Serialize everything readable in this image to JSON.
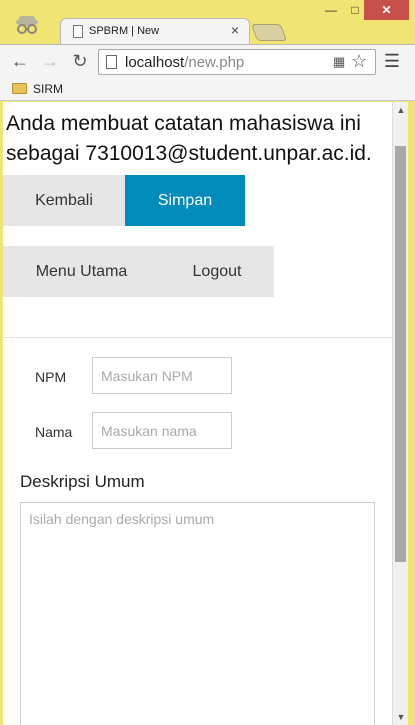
{
  "browser": {
    "tab_title": "SPBRM | New",
    "url_host": "localhost",
    "url_path": "/new.php",
    "bookmark": "SIRM",
    "close_glyph": "×"
  },
  "page": {
    "intro": "Anda membuat catatan mahasiswa ini sebagai 7310013@student.unpar.ac.id.",
    "buttons": {
      "back": "Kembali",
      "save": "Simpan",
      "main_menu": "Menu Utama",
      "logout": "Logout"
    },
    "form": {
      "npm_label": "NPM",
      "npm_placeholder": "Masukan NPM",
      "name_label": "Nama",
      "name_placeholder": "Masukan nama",
      "section_title": "Deskripsi Umum",
      "desc_placeholder": "Isilah dengan deskripsi umum"
    }
  },
  "colors": {
    "accent": "#008cba",
    "frame": "#f0e473",
    "close": "#c7504a"
  },
  "icons": [
    "incognito-icon",
    "page-icon",
    "back-icon",
    "forward-icon",
    "reload-icon",
    "translate-icon",
    "star-icon",
    "menu-icon",
    "folder-icon"
  ]
}
